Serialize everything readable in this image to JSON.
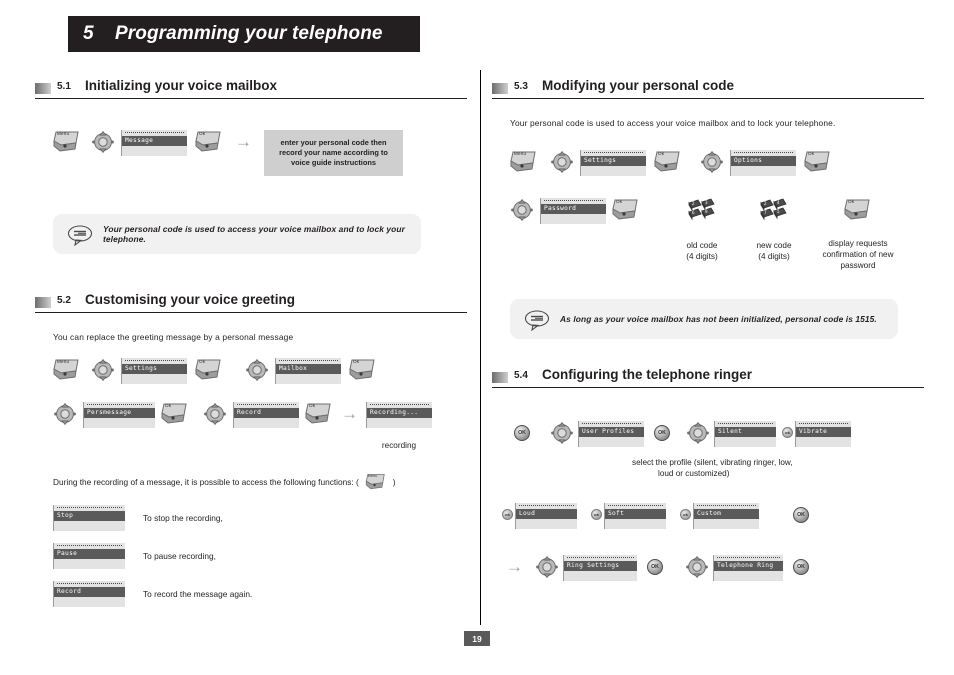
{
  "chapter": {
    "number": "5",
    "title": "Programming your telephone"
  },
  "page_number": "19",
  "labels": {
    "menu_key": "Menu",
    "ok_key": "Ok",
    "ok_round": "OK",
    "ok_round_small": "ok",
    "arrow": "→"
  },
  "sections": {
    "s51": {
      "number": "5.1",
      "title": "Initializing your voice mailbox",
      "display_message": "Message",
      "instruction": "enter your personal code then record your name according to voice guide instructions",
      "note": "Your personal code is used to access your voice mailbox and to lock your telephone."
    },
    "s52": {
      "number": "5.2",
      "title": "Customising your voice greeting",
      "intro": "You can replace the greeting message by a personal message",
      "display_settings": "Settings",
      "display_mailbox": "Mailbox",
      "display_persmessage": "Persmessage",
      "display_record": "Record",
      "display_recording": "Recording...",
      "recording_caption": "recording",
      "functions_intro_left": "During the recording of a message, it is possible to access the following functions: (",
      "functions_intro_right": ")",
      "functions": [
        {
          "display": "Stop",
          "text": "To stop the recording,"
        },
        {
          "display": "Pause",
          "text": "To pause recording,"
        },
        {
          "display": "Record",
          "text": "To record the message again."
        }
      ]
    },
    "s53": {
      "number": "5.3",
      "title": "Modifying your personal code",
      "intro": "Your personal code is used to access your voice mailbox and to lock your telephone.",
      "display_settings": "Settings",
      "display_options": "Options",
      "display_password": "Password",
      "caption_old": "old code\n(4 digits)",
      "caption_old_l1": "old code",
      "caption_old_l2": "(4 digits)",
      "caption_new_l1": "new code",
      "caption_new_l2": "(4 digits)",
      "caption_confirm_l1": "display requests",
      "caption_confirm_l2": "confirmation of new",
      "caption_confirm_l3": "password",
      "note": "As long as your voice mailbox has not been initialized, personal code is 1515."
    },
    "s54": {
      "number": "5.4",
      "title": "Configuring the telephone ringer",
      "display_user_profiles": "User Profiles",
      "display_silent": "Silent",
      "display_vibrate": "Vibrate",
      "display_loud": "Loud",
      "display_soft": "Soft",
      "display_custom": "Custom",
      "display_ring_settings": "Ring Settings",
      "display_telephone_ring": "Telephone Ring",
      "caption_l1": "select the profile (silent, vibrating ringer, low,",
      "caption_l2": "loud or customized)"
    }
  }
}
